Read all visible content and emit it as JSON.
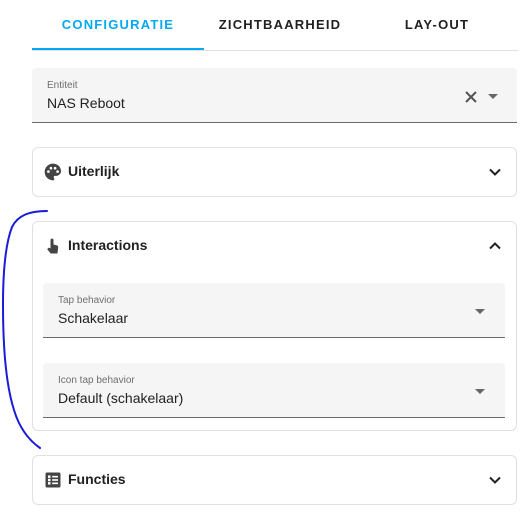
{
  "tabs": [
    {
      "label": "CONFIGURATIE",
      "active": true
    },
    {
      "label": "ZICHTBAARHEID",
      "active": false
    },
    {
      "label": "LAY-OUT",
      "active": false
    }
  ],
  "entity": {
    "label": "Entiteit",
    "value": "NAS Reboot",
    "clear_icon": "close-icon",
    "dropdown_icon": "caret-down-icon"
  },
  "sections": {
    "appearance": {
      "title": "Uiterlijk",
      "icon": "palette-icon",
      "expanded": false
    },
    "interactions": {
      "title": "Interactions",
      "icon": "gesture-tap-icon",
      "expanded": true,
      "tap_behavior": {
        "label": "Tap behavior",
        "value": "Schakelaar"
      },
      "icon_tap_behavior": {
        "label": "Icon tap behavior",
        "value": "Default (schakelaar)"
      }
    },
    "features": {
      "title": "Functies",
      "icon": "list-box-icon",
      "expanded": false
    }
  },
  "colors": {
    "accent": "#03a9f4",
    "annotation": "#1a1adb",
    "field_bg": "#f5f5f5",
    "border": "#e0e0e0"
  }
}
